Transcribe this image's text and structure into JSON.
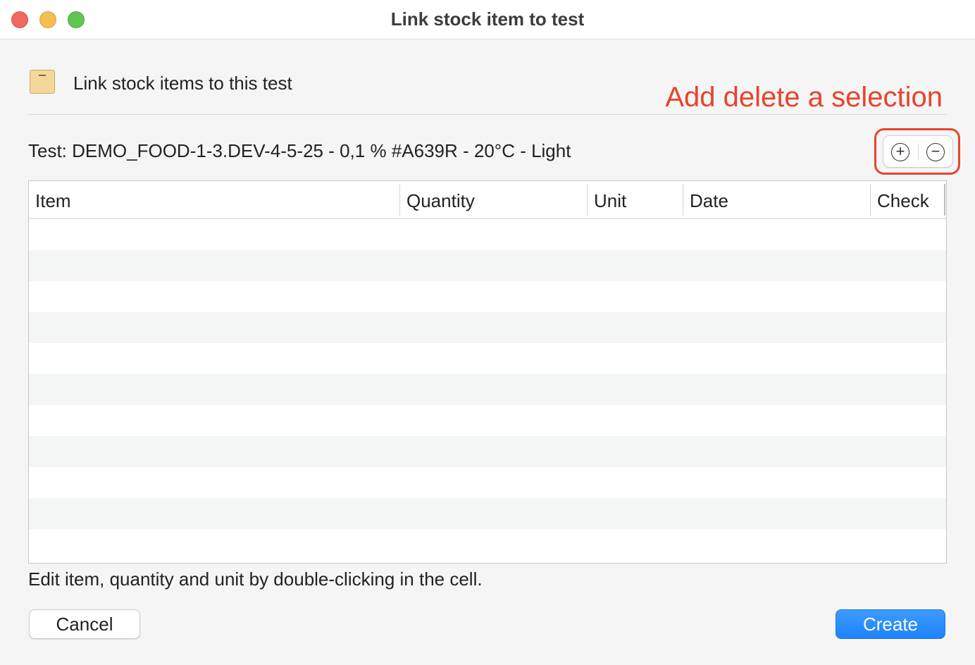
{
  "window": {
    "title": "Link stock item to test"
  },
  "header": {
    "text": "Link stock items to this test",
    "icon": "box-icon"
  },
  "annotation": {
    "text": "Add delete a selection",
    "color": "#e8432c"
  },
  "test": {
    "label": "Test: DEMO_FOOD-1-3.DEV-4-5-25 - 0,1 % #A639R - 20°C - Light"
  },
  "toolbar": {
    "add_symbol": "+",
    "remove_symbol": "−"
  },
  "table": {
    "columns": [
      {
        "label": "Item"
      },
      {
        "label": "Quantity"
      },
      {
        "label": "Unit"
      },
      {
        "label": "Date"
      },
      {
        "label": "Check"
      }
    ],
    "rows": []
  },
  "hint": {
    "text": "Edit item, quantity and unit by double-clicking in the cell."
  },
  "buttons": {
    "cancel_label": "Cancel",
    "create_label": "Create",
    "accent_color": "#1f82fb"
  }
}
